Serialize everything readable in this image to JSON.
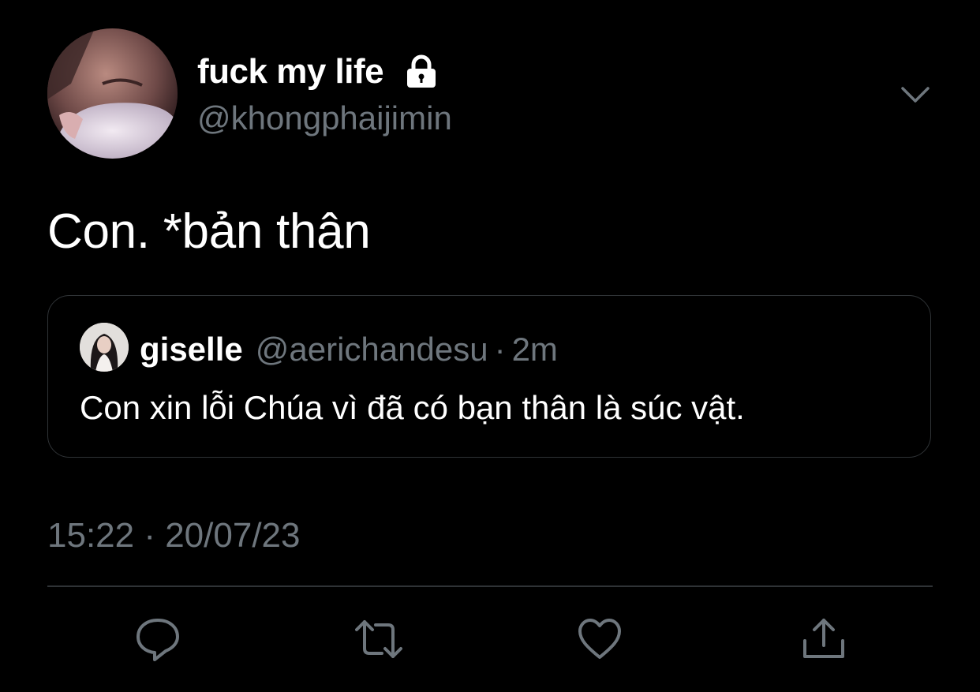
{
  "author": {
    "display_name": "fuck my life",
    "handle": "@khongphaijimin",
    "protected": true,
    "icons": {
      "lock": "lock-icon",
      "more": "chevron-down-icon"
    }
  },
  "tweet": {
    "text": "Con. *bản thân",
    "timestamp": "15:22 · 20/07/23"
  },
  "quoted_tweet": {
    "name": "giselle",
    "handle": "@aerichandesu",
    "separator": "·",
    "time": "2m",
    "text": "Con xin lỗi Chúa vì đã có bạn thân là súc vật."
  },
  "actions": [
    {
      "name": "reply",
      "icon": "speech-bubble-icon"
    },
    {
      "name": "retweet",
      "icon": "retweet-icon"
    },
    {
      "name": "like",
      "icon": "heart-icon"
    },
    {
      "name": "share",
      "icon": "share-icon"
    }
  ],
  "colors": {
    "background": "#000000",
    "text_primary": "#ffffff",
    "text_secondary": "#6e767d",
    "border": "#2f3336"
  }
}
